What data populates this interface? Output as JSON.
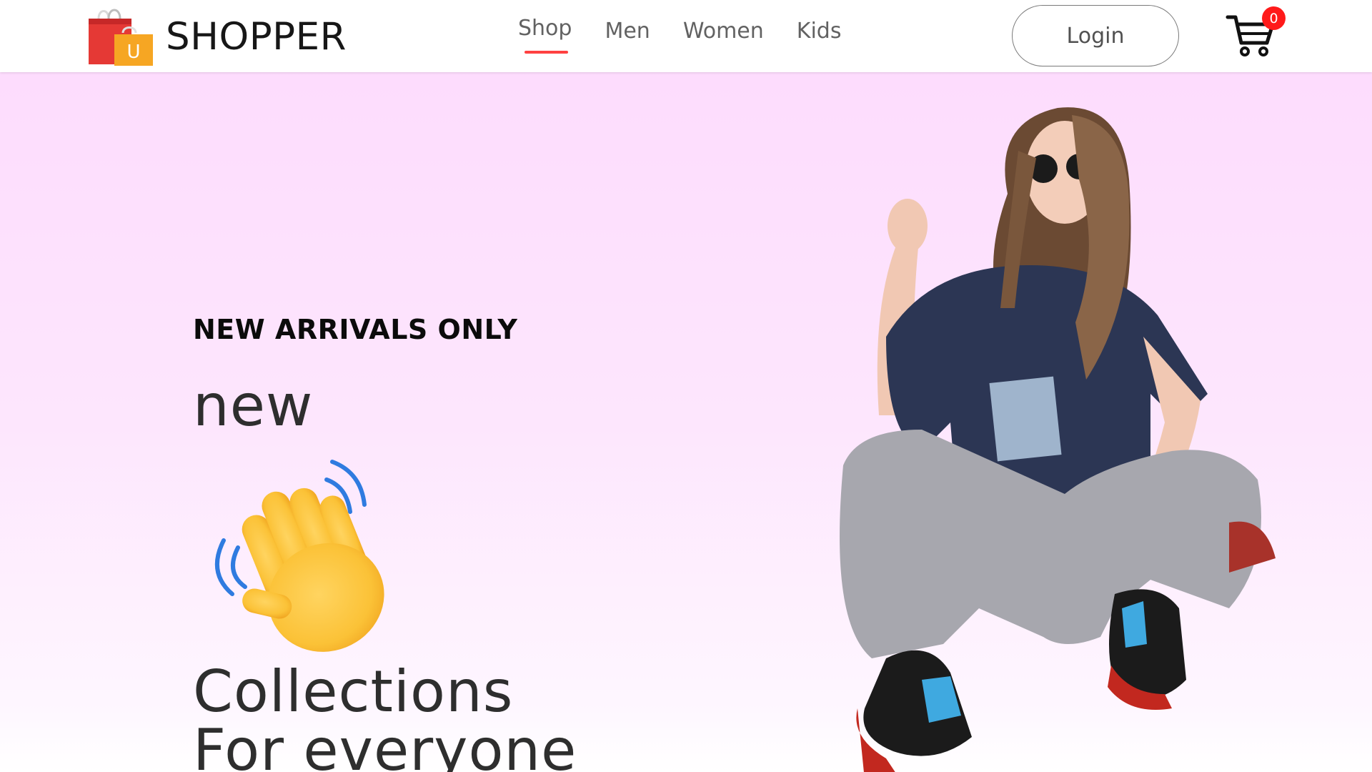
{
  "brand": {
    "name": "SHOPPER",
    "bag_letter": "U"
  },
  "nav": {
    "items": [
      {
        "label": "Shop",
        "active": true
      },
      {
        "label": "Men",
        "active": false
      },
      {
        "label": "Women",
        "active": false
      },
      {
        "label": "Kids",
        "active": false
      }
    ],
    "login_label": "Login",
    "cart_count": "0"
  },
  "hero": {
    "label": "NEW ARRIVALS ONLY",
    "word": "new",
    "emoji": "waving-hand",
    "line1": "Collections",
    "line2": "For everyone"
  },
  "colors": {
    "accent": "#ff4141",
    "hero_bg_top": "#fddcfd",
    "text_dark": "#2e2e2e",
    "cart_badge": "#ff1a1a"
  }
}
